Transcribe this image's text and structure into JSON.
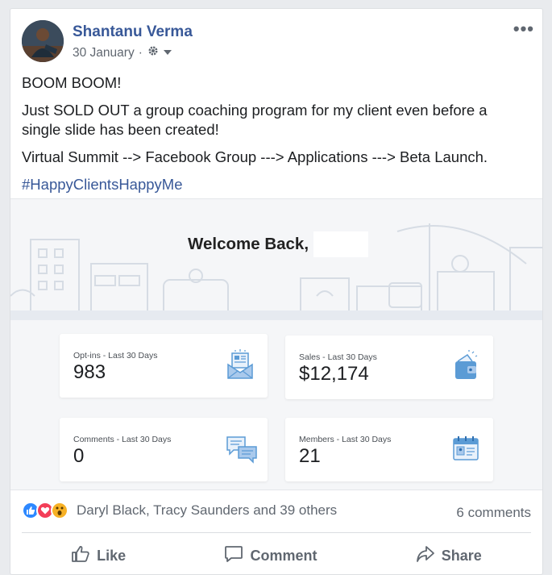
{
  "post": {
    "author": "Shantanu Verma",
    "date": "30 January",
    "separator": "·",
    "more_label": "•••",
    "paragraphs": [
      "BOOM BOOM!",
      "Just SOLD OUT a group coaching program for my client even before a single slide has been created!",
      "Virtual Summit --> Facebook Group ---> Applications ---> Beta Launch."
    ],
    "hashtag": "#HappyClientsHappyMe"
  },
  "dashboard": {
    "welcome": "Welcome Back,",
    "stats": [
      {
        "label": "Opt-ins - Last 30 Days",
        "value": "983",
        "icon": "newsletter-icon"
      },
      {
        "label": "Sales - Last 30 Days",
        "value": "$12,174",
        "icon": "wallet-icon"
      },
      {
        "label": "Comments - Last 30 Days",
        "value": "0",
        "icon": "chat-bubbles-icon"
      },
      {
        "label": "Members - Last 30 Days",
        "value": "21",
        "icon": "calendar-member-icon"
      }
    ]
  },
  "engagement": {
    "reactors": "Daryl Black, Tracy Saunders and 39 others",
    "comments": "6 comments"
  },
  "actions": {
    "like": "Like",
    "comment": "Comment",
    "share": "Share"
  },
  "colors": {
    "link_blue": "#385898",
    "text": "#1c1e21",
    "muted": "#606770",
    "icon_blue": "#5b9bd5"
  }
}
